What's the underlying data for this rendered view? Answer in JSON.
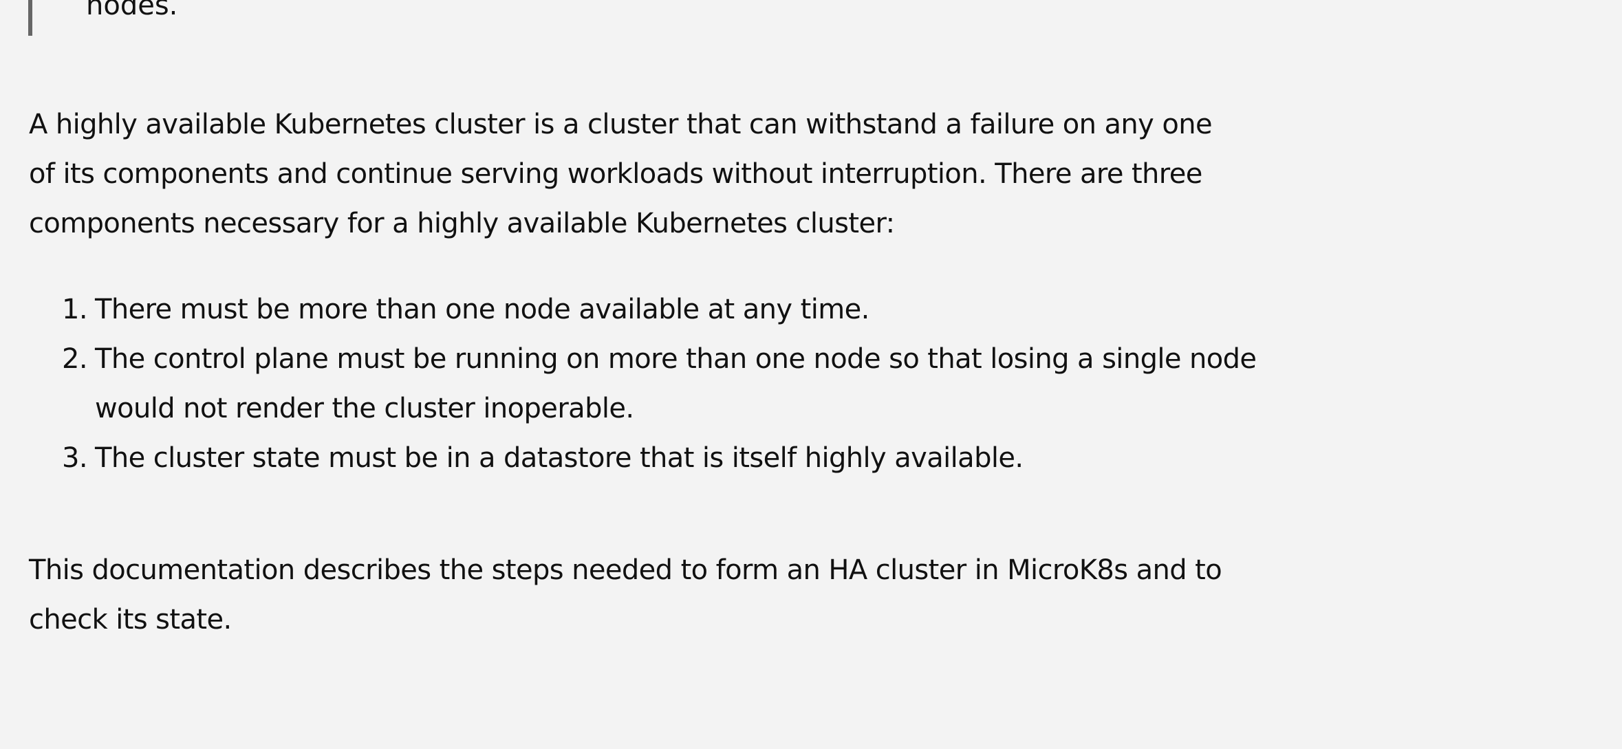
{
  "blockquote": {
    "tail_text": "nodes."
  },
  "intro": {
    "lines": [
      "A highly available Kubernetes cluster is a cluster that can withstand a failure on any one",
      "of its components and continue serving workloads without interruption. There are three",
      "components necessary for a highly available Kubernetes cluster:"
    ]
  },
  "requirements": [
    {
      "number": "1.",
      "lines": [
        "There must be more than one node available at any time."
      ]
    },
    {
      "number": "2.",
      "lines": [
        "The control plane must be running on more than one node so that losing a single node",
        "would not render the cluster inoperable."
      ]
    },
    {
      "number": "3.",
      "lines": [
        "The cluster state must be in a datastore that is itself highly available."
      ]
    }
  ],
  "outro": {
    "lines": [
      "This documentation describes the steps needed to form an HA cluster in MicroK8s and to",
      "check its state."
    ]
  }
}
